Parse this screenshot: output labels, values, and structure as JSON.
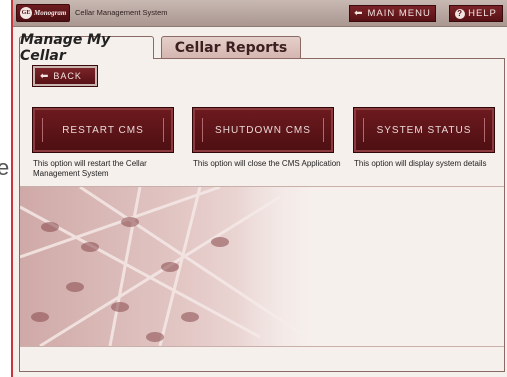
{
  "stray_fragment": "e",
  "header": {
    "logo_ge": "GE",
    "logo_text": "Monogram",
    "app_title": "Cellar Management System",
    "main_menu_label": "MAIN MENU",
    "help_label": "HELP"
  },
  "tabs": [
    {
      "label": "Manage My Cellar",
      "active": true
    },
    {
      "label": "Cellar Reports",
      "active": false
    }
  ],
  "back_label": "BACK",
  "options": [
    {
      "label": "RESTART CMS",
      "description": "This option will restart the Cellar Management System"
    },
    {
      "label": "SHUTDOWN CMS",
      "description": "This option will close the CMS Application"
    },
    {
      "label": "SYSTEM STATUS",
      "description": "This option will display system details"
    }
  ],
  "colors": {
    "accent": "#5a1316",
    "panel_bg": "#f6f0ec",
    "frame_border": "#c8353c"
  }
}
